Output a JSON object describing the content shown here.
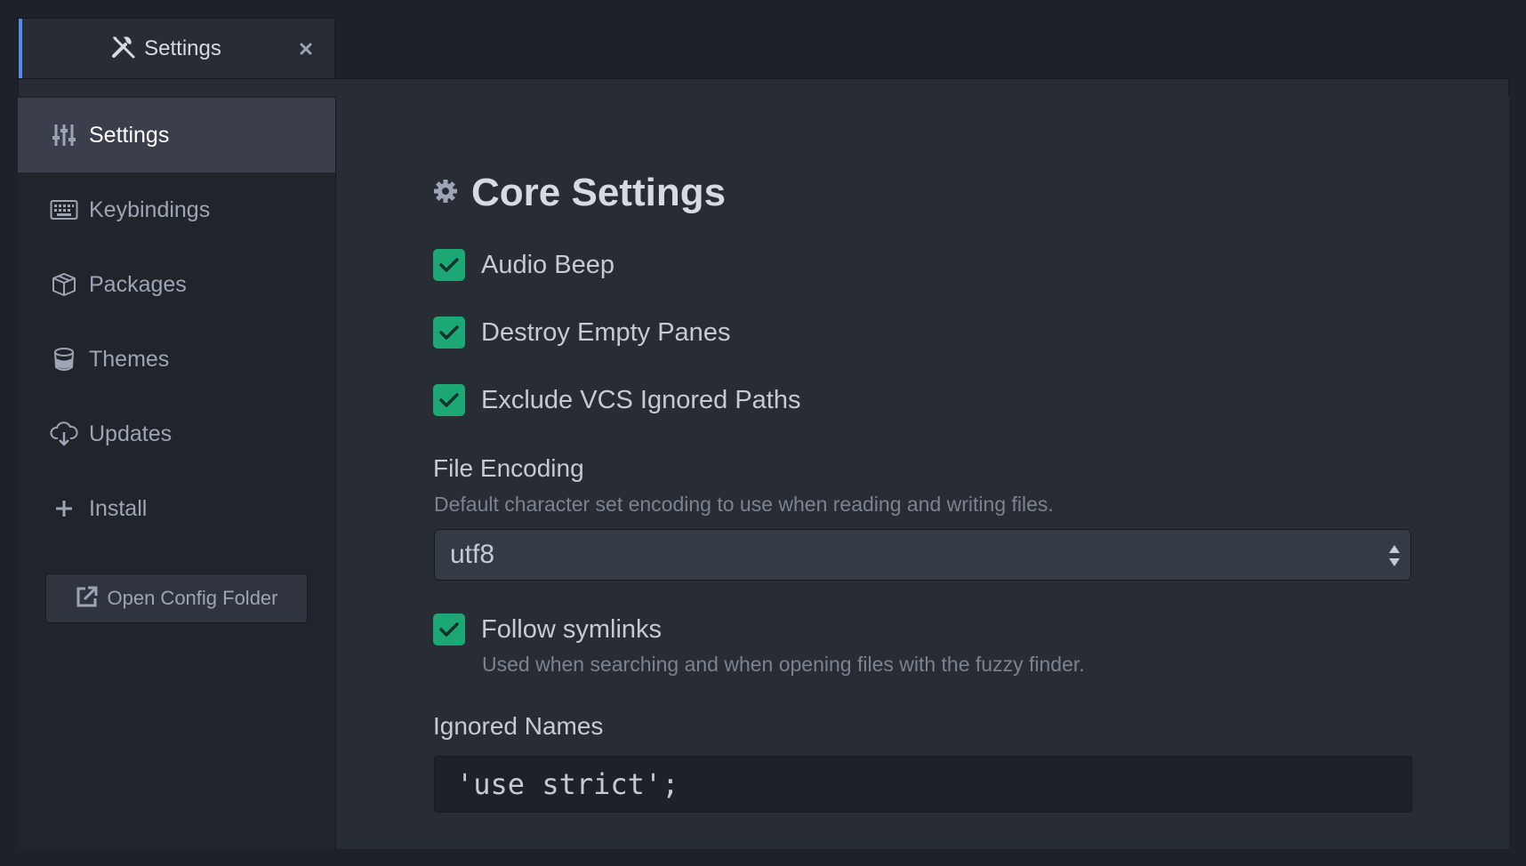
{
  "tab": {
    "title": "Settings",
    "icon": "tools-icon",
    "close_icon": "close-icon"
  },
  "sidebar": {
    "items": [
      {
        "label": "Settings",
        "icon": "sliders-icon",
        "selected": true
      },
      {
        "label": "Keybindings",
        "icon": "keyboard-icon",
        "selected": false
      },
      {
        "label": "Packages",
        "icon": "package-icon",
        "selected": false
      },
      {
        "label": "Themes",
        "icon": "paintcan-icon",
        "selected": false
      },
      {
        "label": "Updates",
        "icon": "cloud-download-icon",
        "selected": false
      },
      {
        "label": "Install",
        "icon": "plus-icon",
        "selected": false
      }
    ],
    "open_config_label": "Open Config Folder",
    "open_config_icon": "link-external-icon"
  },
  "main": {
    "section_title": "Core Settings",
    "section_icon": "gear-icon",
    "settings": {
      "audio_beep": {
        "label": "Audio Beep",
        "checked": true
      },
      "destroy_empty_panes": {
        "label": "Destroy Empty Panes",
        "checked": true
      },
      "exclude_vcs": {
        "label": "Exclude VCS Ignored Paths",
        "checked": true
      },
      "file_encoding": {
        "label": "File Encoding",
        "description": "Default character set encoding to use when reading and writing files.",
        "value": "utf8"
      },
      "follow_symlinks": {
        "label": "Follow symlinks",
        "description": "Used when searching and when opening files with the fuzzy finder.",
        "checked": true
      },
      "ignored_names": {
        "label": "Ignored Names",
        "value": "'use strict';"
      }
    }
  },
  "colors": {
    "accent": "#568af2",
    "checkbox": "#1ba874",
    "background": "#282c34",
    "sidebar": "#21252b",
    "selected_item": "#3a3f4b"
  }
}
